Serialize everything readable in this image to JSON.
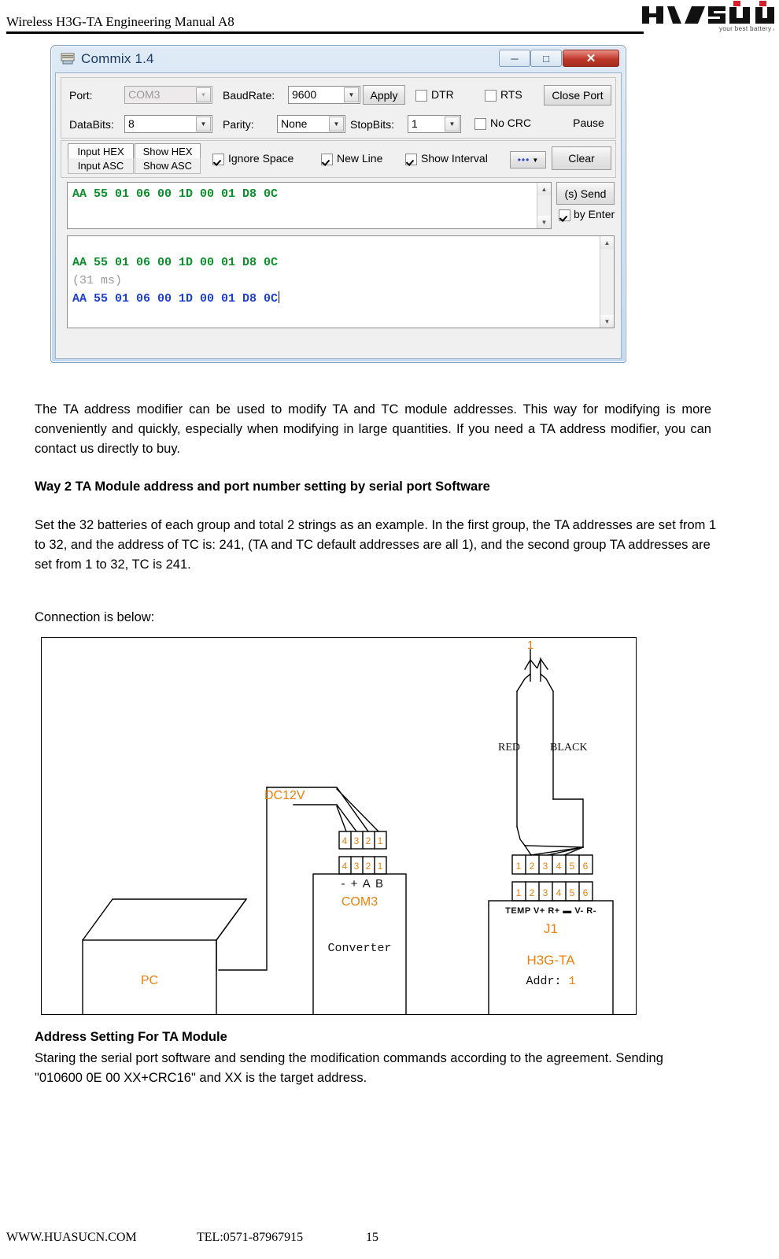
{
  "header": {
    "title": "Wireless H3G-TA Engineering Manual A8",
    "logo_text": "HUASU",
    "logo_tagline": "your best battery advisor"
  },
  "commix": {
    "window_title": "Commix 1.4",
    "window_buttons": {
      "minimize": "─",
      "maximize": "□",
      "close": "✕"
    },
    "labels": {
      "port": "Port:",
      "baudrate": "BaudRate:",
      "databits": "DataBits:",
      "parity": "Parity:",
      "stopbits": "StopBits:"
    },
    "values": {
      "port": "COM3",
      "baudrate": "9600",
      "databits": "8",
      "parity": "None",
      "stopbits": "1"
    },
    "buttons": {
      "apply": "Apply",
      "close_port": "Close Port",
      "pause": "Pause",
      "clear": "Clear",
      "send": "(s) Send",
      "more": "•••"
    },
    "checkboxes": {
      "dtr": {
        "label": "DTR",
        "checked": false
      },
      "rts": {
        "label": "RTS",
        "checked": false
      },
      "no_crc": {
        "label": "No CRC",
        "checked": false
      },
      "ignore_space": {
        "label": "Ignore Space",
        "checked": true
      },
      "new_line": {
        "label": "New Line",
        "checked": true
      },
      "show_interval": {
        "label": "Show Interval",
        "checked": true
      },
      "by_enter": {
        "label": "by Enter",
        "checked": true
      }
    },
    "format_toggles": {
      "input_hex": "Input HEX",
      "input_asc": "Input ASC",
      "show_hex": "Show HEX",
      "show_asc": "Show ASC"
    },
    "send_box": {
      "line1": "AA 55 01 06 00 1D 00 01 D8 0C"
    },
    "receive_box": {
      "line1": "AA 55 01 06 00 1D 00 01 D8 0C",
      "line2": "(31 ms)",
      "line3": "AA 55 01 06 00 1D 00 01 D8 0C"
    },
    "colors": {
      "sent_text": "#0a8f2a",
      "received_text": "#1d3fd0",
      "interval_text": "#9a9a9a",
      "close_button": "#c0392b"
    }
  },
  "body": {
    "para1": "The TA address modifier can be used to modify TA and TC module addresses. This way for modifying is more conveniently and quickly, especially when modifying in large quantities. If you need a TA address modifier, you can contact us directly to buy.",
    "heading1": "Way 2 TA Module address and port number setting by serial port Software",
    "para2": "Set the 32 batteries of each group and total 2 strings as an example. In the first group, the TA addresses are set from 1 to 32, and the address of TC is: 241, (TA and TC default addresses are all 1), and the second group TA addresses are set from 1 to 32, TC is 241.",
    "para3": "Connection is below:",
    "heading2": "Address Setting For TA Module",
    "para4": "Staring the serial port software and sending the modification commands according to the agreement. Sending \"010600 0E 00 XX+CRC16\" and XX is the target address."
  },
  "diagram": {
    "battery_label": "1",
    "wire_red": "RED",
    "wire_black": "BLACK",
    "pc_label": "PC",
    "dc_label": "DC12V",
    "dc_pins": [
      "4",
      "3",
      "2",
      "1"
    ],
    "converter_pins": [
      "4",
      "3",
      "2",
      "1"
    ],
    "converter_pin_names": "- + A B",
    "converter_port": "COM3",
    "converter_label": "Converter",
    "ta_harness_pins": [
      "1",
      "2",
      "3",
      "4",
      "5",
      "6"
    ],
    "ta_module_pins": [
      "1",
      "2",
      "3",
      "4",
      "5",
      "6"
    ],
    "ta_pin_names": "TEMP V+ R+ ▬ V- R-",
    "ta_connector": "J1",
    "ta_model": "H3G-TA",
    "ta_addr": "Addr: 1",
    "accent_color": "#e8820c"
  },
  "footer": {
    "website": "WWW.HUASUCN.COM",
    "tel": "TEL:0571-87967915",
    "page": "15"
  }
}
